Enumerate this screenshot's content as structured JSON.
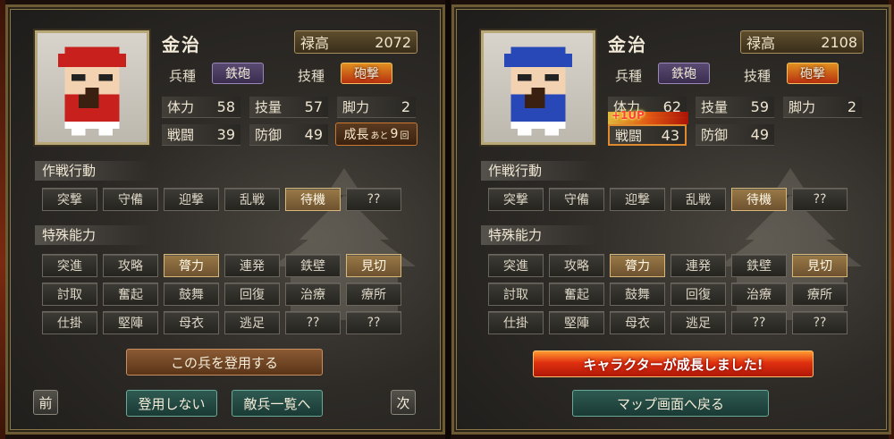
{
  "left": {
    "name": "金治",
    "kokudaka": {
      "label": "禄高",
      "value": "2072"
    },
    "heishu": {
      "label": "兵種",
      "value": "鉄砲"
    },
    "gishu": {
      "label": "技種",
      "value": "砲撃"
    },
    "stats": {
      "tairyoku": {
        "label": "体力",
        "value": "58"
      },
      "giryou": {
        "label": "技量",
        "value": "57"
      },
      "kyakuryoku": {
        "label": "脚力",
        "value": "2"
      },
      "sentou": {
        "label": "戦闘",
        "value": "39"
      },
      "bougyo": {
        "label": "防御",
        "value": "49"
      }
    },
    "growth": {
      "label": "成長",
      "small": "あと",
      "value": "9",
      "unit": "回"
    },
    "sakusen_title": "作戦行動",
    "sakusen": [
      "突撃",
      "守備",
      "迎撃",
      "乱戦",
      "待機",
      "??"
    ],
    "sakusen_active": [
      4
    ],
    "tokushu_title": "特殊能力",
    "tokushu": [
      [
        "突進",
        "攻略",
        "膂力",
        "連発",
        "鉄壁",
        "見切"
      ],
      [
        "討取",
        "奮起",
        "鼓舞",
        "回復",
        "治療",
        "療所"
      ],
      [
        "仕掛",
        "堅陣",
        "母衣",
        "逃足",
        "??",
        "??"
      ]
    ],
    "recruit": "この兵を登用する",
    "prev": "前",
    "next": "次",
    "decline": "登用しない",
    "list": "敵兵一覧へ"
  },
  "right": {
    "name": "金治",
    "kokudaka": {
      "label": "禄高",
      "value": "2108"
    },
    "heishu": {
      "label": "兵種",
      "value": "鉄砲"
    },
    "gishu": {
      "label": "技種",
      "value": "砲撃"
    },
    "stats": {
      "tairyoku": {
        "label": "体力",
        "value": "62"
      },
      "giryou": {
        "label": "技量",
        "value": "59"
      },
      "kyakuryoku": {
        "label": "脚力",
        "value": "2"
      },
      "sentou": {
        "label": "戦闘",
        "value": "43"
      },
      "bougyo": {
        "label": "防御",
        "value": "49"
      }
    },
    "oneup": "+1UP",
    "sakusen_title": "作戦行動",
    "sakusen": [
      "突撃",
      "守備",
      "迎撃",
      "乱戦",
      "待機",
      "??"
    ],
    "tokushu_title": "特殊能力",
    "tokushu": [
      [
        "突進",
        "攻略",
        "膂力",
        "連発",
        "鉄壁",
        "見切"
      ],
      [
        "討取",
        "奮起",
        "鼓舞",
        "回復",
        "治療",
        "療所"
      ],
      [
        "仕掛",
        "堅陣",
        "母衣",
        "逃足",
        "??",
        "??"
      ]
    ],
    "banner": "キャラクターが成長しました!",
    "back": "マップ画面へ戻る"
  },
  "colors": {
    "left_outfit": "#c8201c",
    "right_outfit": "#2848b8"
  }
}
